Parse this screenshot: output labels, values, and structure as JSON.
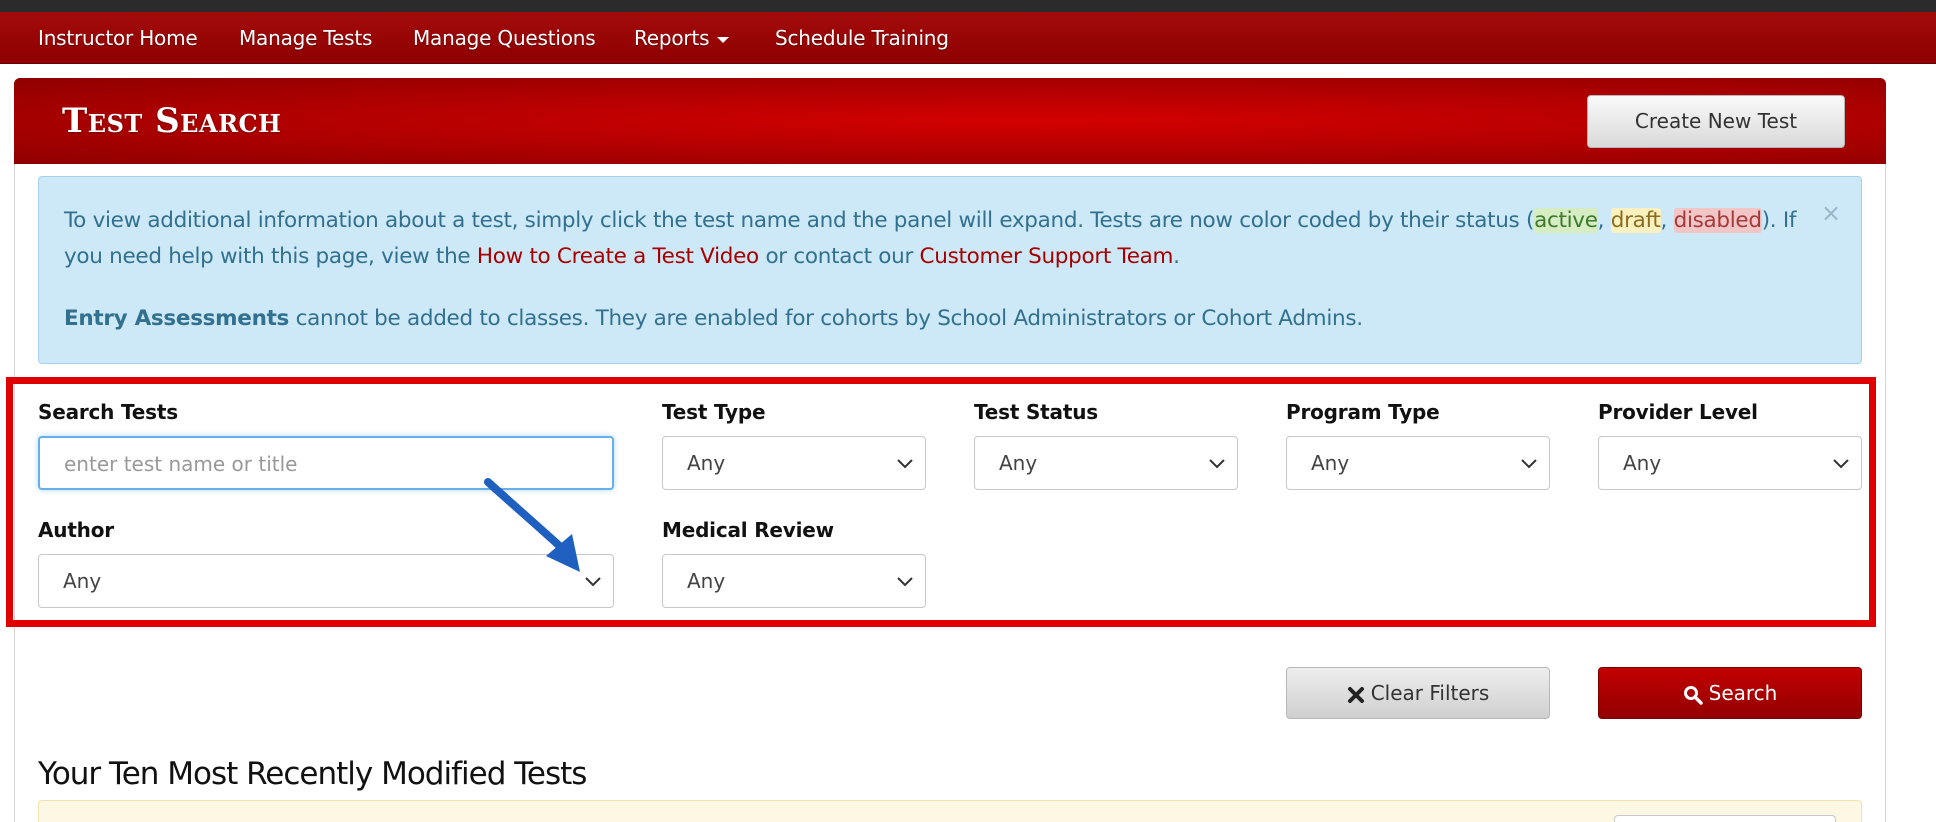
{
  "nav": {
    "items": [
      {
        "label": "Instructor Home"
      },
      {
        "label": "Manage Tests"
      },
      {
        "label": "Manage Questions"
      },
      {
        "label": "Reports"
      },
      {
        "label": "Schedule Training"
      }
    ]
  },
  "header": {
    "title": "Test Search",
    "create_button": "Create New Test"
  },
  "alert": {
    "p1_a": "To view additional information about a test, simply click the test name and the panel will expand. Tests are now color coded by their status (",
    "status_active": "active",
    "sep1": ", ",
    "status_draft": "draft",
    "sep2": ", ",
    "status_disabled": "disabled",
    "p1_b": "). If you need help with this page, view the ",
    "link_video": "How to Create a Test Video",
    "p1_c": " or contact our ",
    "link_support": "Customer Support Team",
    "p1_d": ".",
    "p2_bold": "Entry Assessments",
    "p2_rest": " cannot be added to classes. They are enabled for cohorts by School Administrators or Cohort Admins.",
    "close": "×"
  },
  "filters": {
    "search": {
      "label": "Search Tests",
      "placeholder": "enter test name or title"
    },
    "test_type": {
      "label": "Test Type",
      "value": "Any"
    },
    "test_status": {
      "label": "Test Status",
      "value": "Any"
    },
    "program_type": {
      "label": "Program Type",
      "value": "Any"
    },
    "provider_level": {
      "label": "Provider Level",
      "value": "Any"
    },
    "author": {
      "label": "Author",
      "value": "Any"
    },
    "medical_review": {
      "label": "Medical Review",
      "value": "Any"
    }
  },
  "actions": {
    "clear": "Clear Filters",
    "search": "Search"
  },
  "recent": {
    "title": "Your Ten Most Recently Modified Tests"
  },
  "colors": {
    "brand_red": "#a30b0b",
    "highlight_box": "#e00000",
    "alert_bg": "#cde8f6",
    "annotation_arrow": "#1f5fbf"
  }
}
